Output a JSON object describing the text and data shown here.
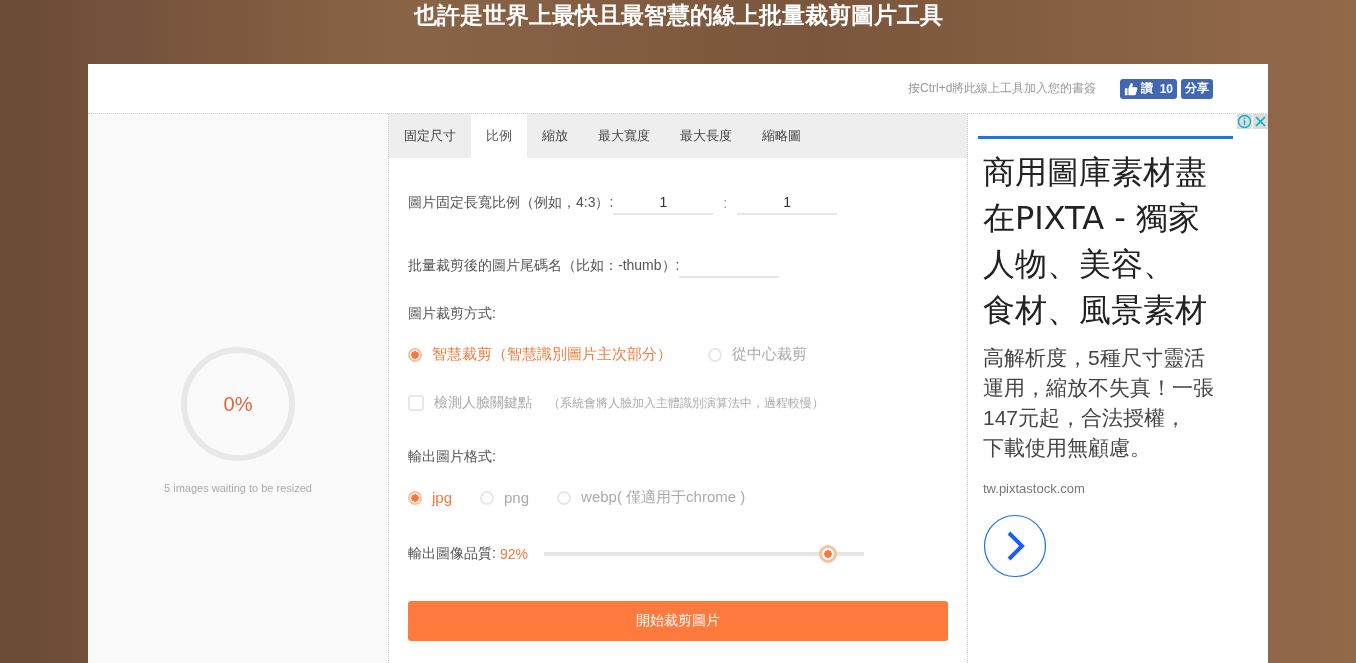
{
  "header": {
    "title": "也許是世界上最快且最智慧的線上批量裁剪圖片工具"
  },
  "toolbar": {
    "bookmark_hint": "按Ctrl+d將此線上工具加入您的書簽",
    "like_label": "讚",
    "like_count": "10",
    "share_label": "分享"
  },
  "progress": {
    "percent": "0%",
    "caption": "5 images waiting to be resized"
  },
  "tabs": [
    {
      "label": "固定尺寸",
      "selected": false
    },
    {
      "label": "比例",
      "selected": true
    },
    {
      "label": "縮放",
      "selected": false
    },
    {
      "label": "最大寬度",
      "selected": false
    },
    {
      "label": "最大長度",
      "selected": false
    },
    {
      "label": "縮略圖",
      "selected": false
    }
  ],
  "ratio": {
    "label": "圖片固定長寬比例（例如，4:3）:",
    "value_1": "1",
    "separator": ":",
    "value_2": "1"
  },
  "suffix": {
    "label": "批量裁剪後的圖片尾碼名（比如：-thumb）:"
  },
  "crop_mode": {
    "label": "圖片裁剪方式:",
    "options": [
      {
        "label": "智慧裁剪（智慧識別圖片主次部分）",
        "selected": true
      },
      {
        "label": "從中心裁剪",
        "selected": false
      }
    ]
  },
  "face_detect": {
    "label": "檢測人臉關鍵點",
    "note": "（系統會將人臉加入主體識別演算法中，過程較慢）",
    "checked": false
  },
  "format": {
    "label": "輸出圖片格式:",
    "options": [
      {
        "label": "jpg",
        "selected": true
      },
      {
        "label": "png",
        "selected": false
      },
      {
        "label": "webp( 僅適用于chrome )",
        "selected": false
      }
    ]
  },
  "quality": {
    "label": "輸出圖像品質:",
    "reading": "92%",
    "level": 0.91
  },
  "start_button": "開始裁剪圖片",
  "ad": {
    "headline": [
      "商用圖庫素材盡",
      "在PIXTA - 獨家",
      "人物、美容、",
      "食材、風景素材"
    ],
    "body": [
      "高解析度，5種尺寸靈活",
      "運用，縮放不失真！一張",
      "147元起，合法授權，",
      "下載使用無顧慮。"
    ],
    "domain": "tw.pixtastock.com"
  }
}
